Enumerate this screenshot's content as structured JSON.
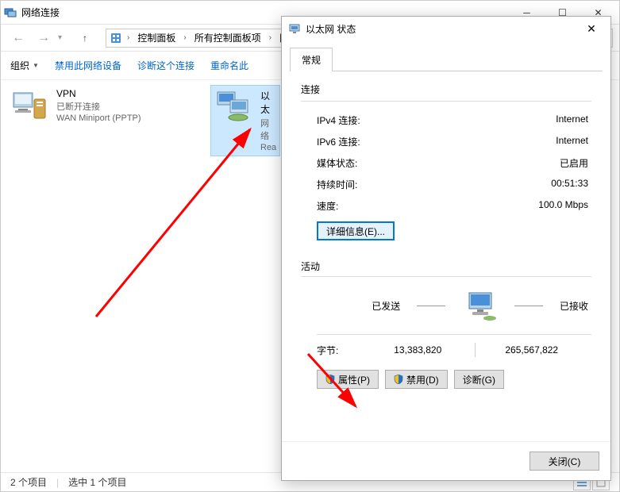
{
  "explorer": {
    "title": "网络连接",
    "breadcrumb": [
      "控制面板",
      "所有控制面板项",
      "网络"
    ],
    "toolbar": {
      "organize": "组织",
      "disable": "禁用此网络设备",
      "diagnose": "诊断这个连接",
      "rename": "重命名此"
    },
    "items": [
      {
        "name": "VPN",
        "status": "已断开连接",
        "device": "WAN Miniport (PPTP)"
      },
      {
        "name": "以太",
        "status": "网络",
        "device": "Rea"
      }
    ],
    "statusbar": {
      "count": "2 个项目",
      "selected": "选中 1 个项目"
    }
  },
  "dialog": {
    "title": "以太网 状态",
    "tab": "常规",
    "section_connection": "连接",
    "conn": {
      "ipv4_label": "IPv4 连接:",
      "ipv4_value": "Internet",
      "ipv6_label": "IPv6 连接:",
      "ipv6_value": "Internet",
      "media_label": "媒体状态:",
      "media_value": "已启用",
      "duration_label": "持续时间:",
      "duration_value": "00:51:33",
      "speed_label": "速度:",
      "speed_value": "100.0 Mbps"
    },
    "details_btn": "详细信息(E)...",
    "section_activity": "活动",
    "activity": {
      "sent_label": "已发送",
      "recv_label": "已接收",
      "bytes_label": "字节:",
      "sent_bytes": "13,383,820",
      "recv_bytes": "265,567,822"
    },
    "buttons": {
      "properties": "属性(P)",
      "disable": "禁用(D)",
      "diagnose": "诊断(G)",
      "close": "关闭(C)"
    }
  }
}
